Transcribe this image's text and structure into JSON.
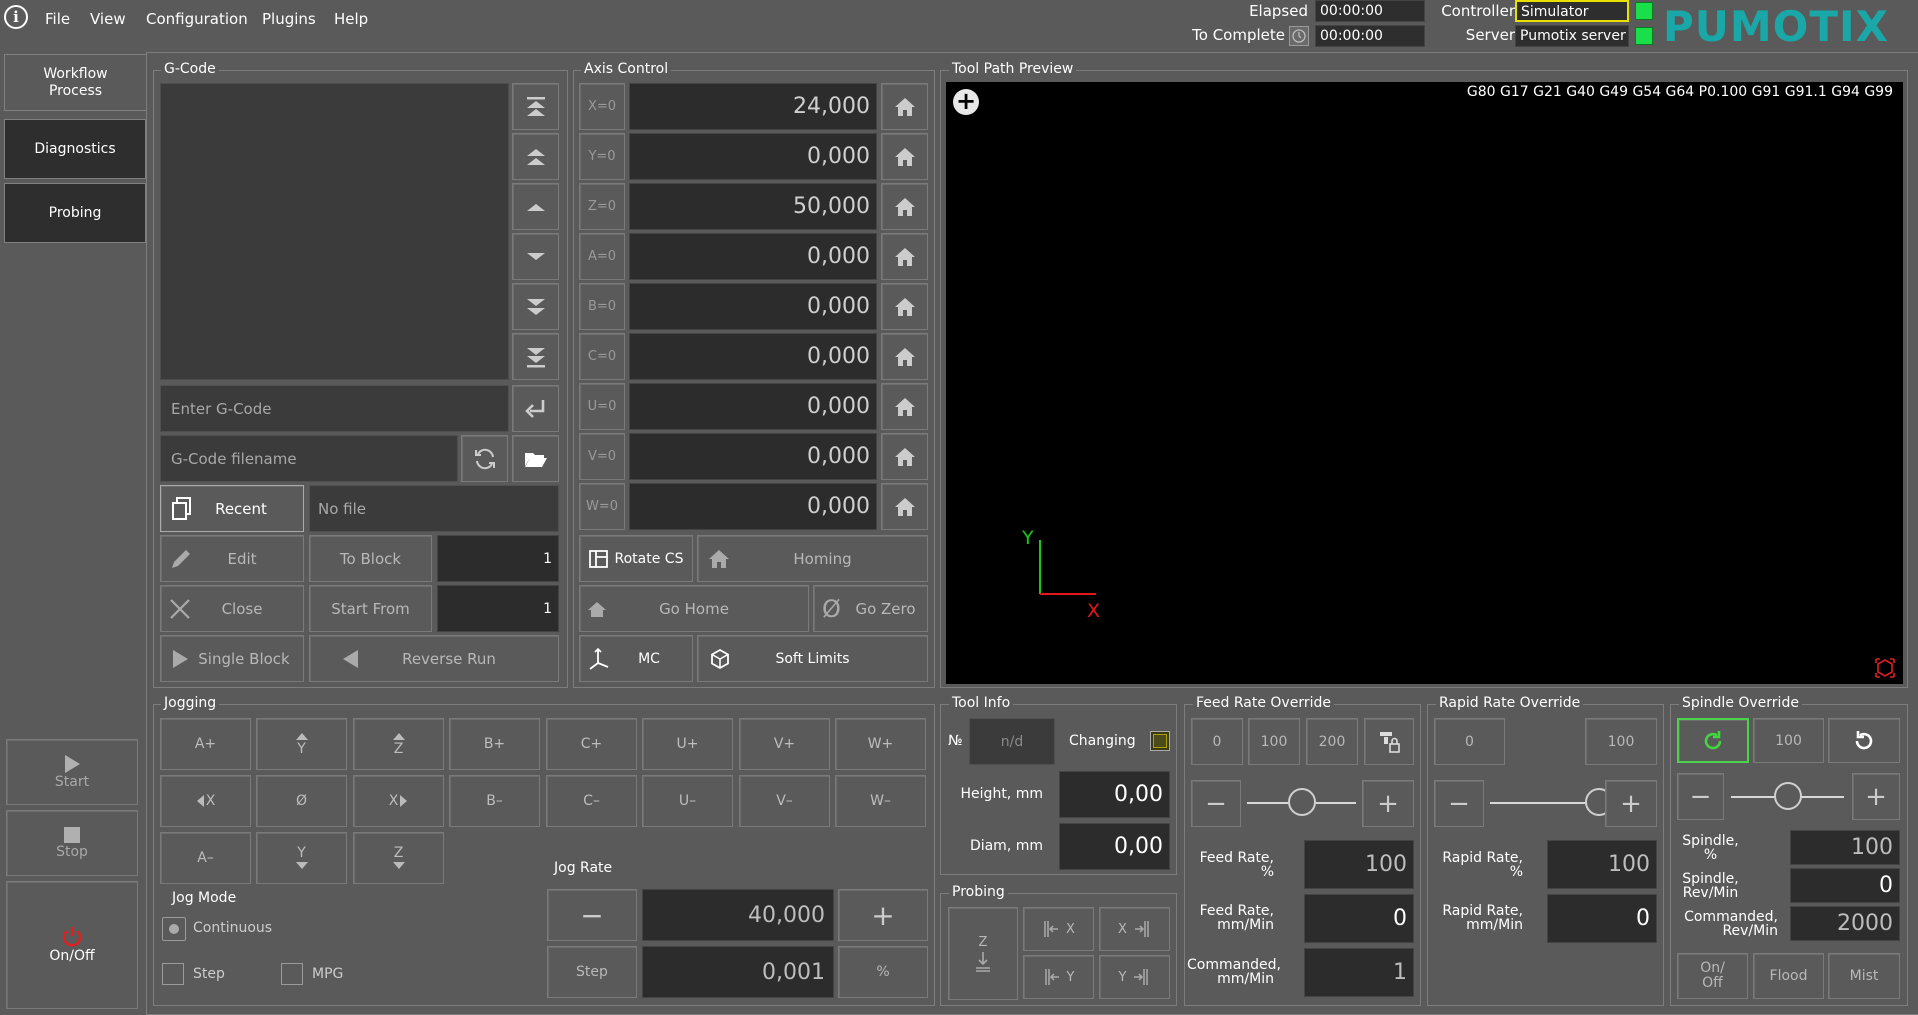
{
  "menu": {
    "file": "File",
    "view": "View",
    "configuration": "Configuration",
    "plugins": "Plugins",
    "help": "Help"
  },
  "status": {
    "elapsed_label": "Elapsed",
    "elapsed_value": "00:00:00",
    "to_complete_label": "To Complete",
    "to_complete_value": "00:00:00",
    "controller_label": "Controller",
    "controller_value": "Simulator",
    "server_label": "Server",
    "server_value": "Pumotix server",
    "brand": "PUMOTIX"
  },
  "sidebar": {
    "workflow": "Workflow\nProcess",
    "diagnostics": "Diagnostics",
    "probing": "Probing",
    "start": "Start",
    "stop": "Stop",
    "onoff": "On/Off"
  },
  "gcode": {
    "title": "G-Code",
    "enter_placeholder": "Enter G-Code",
    "filename_placeholder": "G-Code filename",
    "recent": "Recent",
    "no_file": "No file",
    "edit": "Edit",
    "to_block": "To Block",
    "to_block_value": "1",
    "close": "Close",
    "start_from": "Start From",
    "start_from_value": "1",
    "single_block": "Single Block",
    "reverse_run": "Reverse Run"
  },
  "axis": {
    "title": "Axis Control",
    "rows": [
      {
        "label": "X=0",
        "value": "24,000"
      },
      {
        "label": "Y=0",
        "value": "0,000"
      },
      {
        "label": "Z=0",
        "value": "50,000"
      },
      {
        "label": "A=0",
        "value": "0,000"
      },
      {
        "label": "B=0",
        "value": "0,000"
      },
      {
        "label": "C=0",
        "value": "0,000"
      },
      {
        "label": "U=0",
        "value": "0,000"
      },
      {
        "label": "V=0",
        "value": "0,000"
      },
      {
        "label": "W=0",
        "value": "0,000"
      }
    ],
    "rotate_cs": "Rotate CS",
    "homing": "Homing",
    "go_home": "Go Home",
    "go_zero": "Go Zero",
    "mc": "MC",
    "soft_limits": "Soft Limits"
  },
  "preview": {
    "title": "Tool Path Preview",
    "gcodes": "G80 G17 G21 G40 G49 G54 G64 P0.100 G91 G91.1 G94 G99",
    "y": "Y",
    "x": "X"
  },
  "jogging": {
    "title": "Jogging",
    "row1": [
      "A+",
      "Y",
      "Z",
      "B+",
      "C+",
      "U+",
      "V+",
      "W+"
    ],
    "row2": [
      "X",
      "Ø",
      "X",
      "B–",
      "C–",
      "U–",
      "V–",
      "W–"
    ],
    "row3": [
      "A–",
      "Y",
      "Z"
    ],
    "jog_mode": "Jog Mode",
    "continuous": "Continuous",
    "step": "Step",
    "mpg": "MPG",
    "jog_rate": "Jog Rate",
    "rate_value": "40,000",
    "step_btn": "Step",
    "step_value": "0,001",
    "pct": "%"
  },
  "toolinfo": {
    "title": "Tool Info",
    "no": "№",
    "no_value": "n/d",
    "changing": "Changing",
    "height": "Height, mm",
    "height_value": "0,00",
    "diam": "Diam, mm",
    "diam_value": "0,00"
  },
  "probing": {
    "title": "Probing",
    "z": "Z",
    "x1": "X",
    "x2": "X",
    "y1": "Y",
    "y2": "Y"
  },
  "feed": {
    "title": "Feed Rate Override",
    "b0": "0",
    "b100": "100",
    "b200": "200",
    "rate_pct": "Feed Rate,\n%",
    "rate_pct_value": "100",
    "rate_mm": "Feed Rate,\nmm/Min",
    "rate_mm_value": "0",
    "commanded": "Commanded,\nmm/Min",
    "commanded_value": "1",
    "slider_pct": 0.5
  },
  "rapid": {
    "title": "Rapid Rate Override",
    "b0": "0",
    "b100": "100",
    "rate_pct": "Rapid Rate,\n%",
    "rate_pct_value": "100",
    "rate_mm": "Rapid Rate,\nmm/Min",
    "rate_mm_value": "0",
    "slider_pct": 1.0
  },
  "spindle": {
    "title": "Spindle Override",
    "b100": "100",
    "pct": "Spindle,\n%",
    "pct_value": "100",
    "rev": "Spindle,\nRev/Min",
    "rev_value": "0",
    "commanded": "Commanded,\nRev/Min",
    "commanded_value": "2000",
    "onoff": "On/\nOff",
    "flood": "Flood",
    "mist": "Mist",
    "slider_pct": 0.5
  }
}
